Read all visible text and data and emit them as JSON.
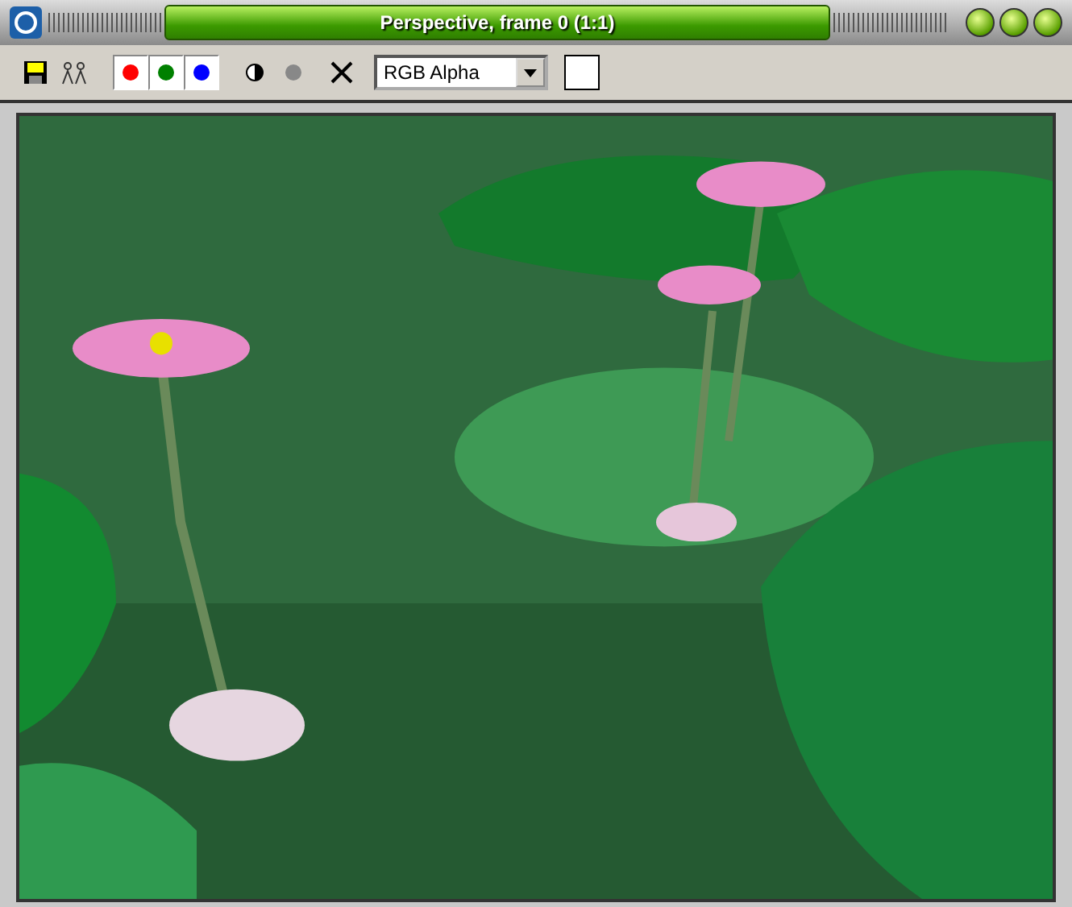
{
  "window": {
    "title": "Perspective, frame 0 (1:1)"
  },
  "toolbar": {
    "channels": [
      {
        "kind": "color",
        "color": "#ff0000",
        "selected": true
      },
      {
        "kind": "color",
        "color": "#008000",
        "selected": true
      },
      {
        "kind": "color",
        "color": "#0000ff",
        "selected": true
      }
    ],
    "monochrome": {
      "on": false
    },
    "alpha": {
      "on": false
    },
    "display_channel": {
      "value": "RGB Alpha"
    },
    "swatch": {
      "color": "#ffffff"
    }
  }
}
